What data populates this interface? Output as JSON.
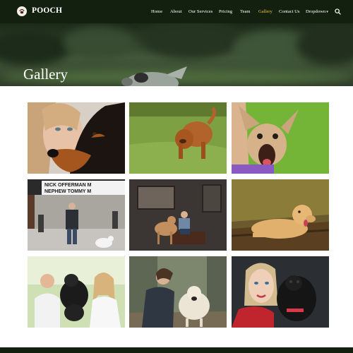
{
  "brand": {
    "name": "POOCH",
    "logo_icon": "paw-icon"
  },
  "nav": {
    "items": [
      {
        "label": "Home"
      },
      {
        "label": "About"
      },
      {
        "label": "Our Services"
      },
      {
        "label": "Pricing"
      },
      {
        "label": "Team"
      },
      {
        "label": "Gallery"
      },
      {
        "label": "Contact Us"
      },
      {
        "label": "Dropdown"
      }
    ],
    "active": "Gallery",
    "dropdown_caret": "▾",
    "search_icon": "search-icon"
  },
  "hero": {
    "title": "Gallery"
  },
  "gallery": {
    "sign_text_1": "NICK OFFERMAN M",
    "sign_text_2": "NEPHEW TOMMY M",
    "images": [
      {
        "name": "woman-with-doberman"
      },
      {
        "name": "shar-pei-on-grass"
      },
      {
        "name": "chihuahua-yawning"
      },
      {
        "name": "man-walking-dog-street"
      },
      {
        "name": "boy-with-dog-studio"
      },
      {
        "name": "golden-retriever-lying"
      },
      {
        "name": "couple-with-black-dog"
      },
      {
        "name": "woman-with-labrador"
      },
      {
        "name": "woman-with-black-terrier"
      }
    ]
  },
  "colors": {
    "nav_bg": "#14200f",
    "active": "#f2c530",
    "text": "#ffffff"
  }
}
